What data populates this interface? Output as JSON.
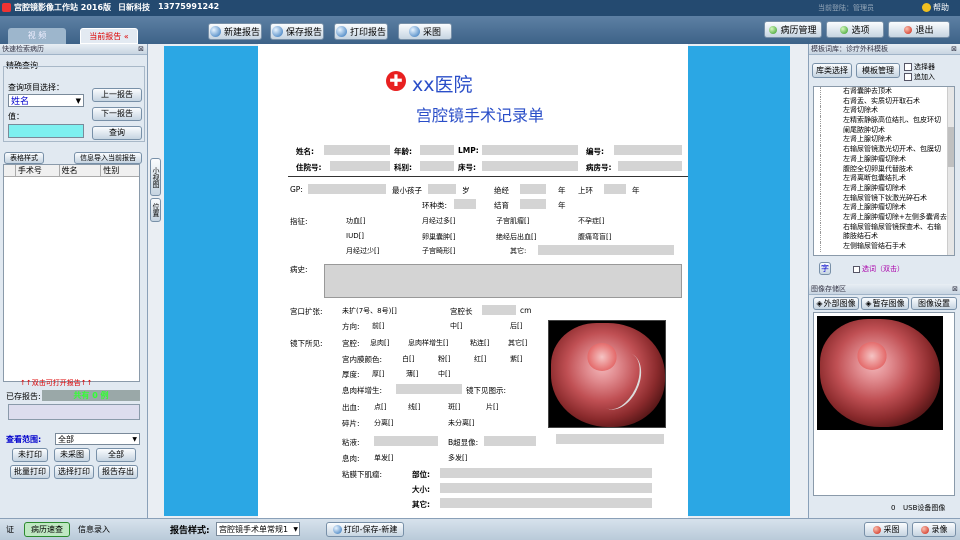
{
  "app": {
    "title": "宫腔镜影像工作站 2016版",
    "company": "日新科技",
    "phone": "13775991242",
    "current_login": "当前登陆：管理员",
    "help": "帮助"
  },
  "tabs": {
    "video": "视 频",
    "current_report": "当前报告 «"
  },
  "toolbar": {
    "new_report": "新建报告",
    "save_report": "保存报告",
    "print_report": "打印报告",
    "capture": "采图",
    "records": "病历管理",
    "options": "选项",
    "exit": "退出"
  },
  "left": {
    "panel_title": "快速检索病历",
    "precise_query": "精确查询",
    "query_item_label": "查询项目选择：",
    "query_item_value": "姓名",
    "value_label": "值：",
    "prev_report": "上一报告",
    "next_report": "下一报告",
    "query": "查询",
    "form_tab": "表格样式",
    "import_tab": "信息导入当前报告",
    "columns": [
      "手术号",
      "姓名",
      "性别"
    ],
    "dblclick_hint": "↑↑双击可打开报告↑↑",
    "saved_reports_label": "已存报告:",
    "saved_count": "共有 0 例",
    "view_range_label": "查看范围:",
    "view_range_value": "全部",
    "unprinted": "未打印",
    "unsaved": "未采图",
    "all": "全部",
    "batch_print": "批量打印",
    "select_print": "选择打印",
    "export_report": "报告存出"
  },
  "vtabs": [
    "小视图",
    "位置"
  ],
  "report": {
    "hospital": "xx医院",
    "title": "宫腔镜手术记录单",
    "row1": [
      "姓名:",
      "年龄:",
      "LMP:",
      "编号:"
    ],
    "row2": [
      "住院号:",
      "科别:",
      "床号:",
      "病房号:"
    ],
    "gp": "GP:",
    "min_child": "最小孩子",
    "years1": "岁",
    "menopause": "绝经",
    "year1": "年",
    "ring": "上环",
    "year2": "年",
    "ring_type": "环种类:",
    "ligation": "结育",
    "year3": "年",
    "indications_label": "指征:",
    "indications": [
      "功血[]",
      "月经过多[]",
      "子宫肌瘤[]",
      "不孕症[]",
      "IUD[]",
      "卵巢囊肿[]",
      "绝经后出血[]",
      "腹痛弯盲[]",
      "月经过少[]",
      "子宫畸形[]",
      "其它:"
    ],
    "history_label": "病史:",
    "dilation_label": "宫口扩张:",
    "dilation_value": "未扩(7号、8号)[]",
    "cavity_len": "宫腔长",
    "unit_cm": "cm",
    "direction_label": "方向:",
    "front": "前[]",
    "middle": "中[]",
    "back": "后[]",
    "findings_label": "镜下所见:",
    "cavity_label": "宫腔:",
    "smooth": "息肉[]",
    "polyp": "息肉样增生[]",
    "adhesion": "粘连[]",
    "others": "其它[]",
    "endo_color_label": "宫内膜颜色:",
    "white": "白[]",
    "pink": "粉[]",
    "red": "红[]",
    "purple": "紫[]",
    "thickness_label": "厚度:",
    "thick": "厚[]",
    "thin": "薄[]",
    "mid": "中[]",
    "polyp_growth_label": "息肉样增生:",
    "image_desc_label": "镜下见图示:",
    "bleeding_label": "出血:",
    "spot": "点[]",
    "line": "线[]",
    "patch": "斑[]",
    "sheet": "片[]",
    "debris_label": "碎片:",
    "separated": "分离[]",
    "unseparated": "未分离[]",
    "adhesion2_label": "粘液:",
    "bscan_label": "B超显像:",
    "polyp2_label": "息肉:",
    "single": "单发[]",
    "multiple": "多发[]",
    "submucosal_label": "粘膜下肌瘤:",
    "position_label": "部位:",
    "size_label": "大小:",
    "other_label": "其它:"
  },
  "right": {
    "template_title": "模板词库：诊疗外科模板",
    "lib_select": "库类选择",
    "template_manage": "模板管理",
    "selector": "选择器",
    "append": "追加入",
    "templates": [
      "右肾囊肿去顶术",
      "右肾盂、实质切开取石术",
      "左肾切除术",
      "左精索静脉高位结扎、包皮环切",
      "阑尾脓肿切术",
      "左肾上腺切除术",
      "右输尿管镜激光切开术、包膜切",
      "左肾上腺肿瘤切除术",
      "腹腔全切卵巢代替肢术",
      "左肾离断包囊结扎术",
      "左肾上腺肿瘤切除术",
      "左输尿管镜下钬激光碎石术",
      "左肾上腺肿瘤切除术",
      "左肾上腺肿瘤切除+左侧多囊肾去",
      "右输尿管输尿管镜探查术、右输",
      "膝肢结石术",
      "左侧输尿管结石手术"
    ],
    "word_btn": "字",
    "multi_select": "选词（双击）",
    "image_store": "图像存储区",
    "external_image": "外部图像",
    "stop_image": "暂存图像",
    "image_settings": "图像设置",
    "usb": "USB设备图像",
    "zero": "0"
  },
  "status": {
    "cert": "证",
    "records_query": "病历速查",
    "info_entry": "信息录入",
    "report_style_label": "报告样式:",
    "report_style_value": "宫腔镜手术单常规1",
    "print_save_new": "打印-保存-新建",
    "capture": "采图",
    "record": "录像"
  },
  "colors": {
    "titlebar": "#244a70",
    "blue_area": "#2ba7e4",
    "accent_green": "#2c9a20",
    "accent_red": "#cc2010"
  }
}
